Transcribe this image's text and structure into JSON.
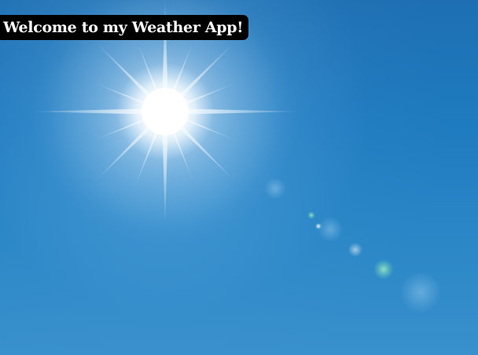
{
  "header": {
    "welcome_text": "Welcome to my Weather App!"
  },
  "background": {
    "description_icon": "sun-in-blue-sky-photo",
    "sky_color": "#1f7bbf",
    "sun_color": "#ffffff"
  }
}
